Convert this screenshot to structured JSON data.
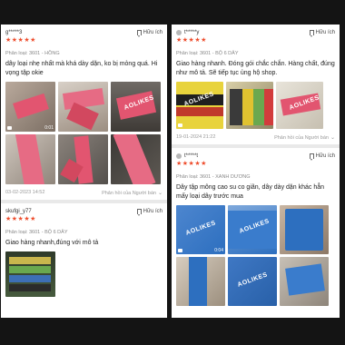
{
  "colors": {
    "star": "#ee4d2d",
    "pink_band": "#e25570",
    "blue_band": "#2d6fbf"
  },
  "save_label": "Hữu ích",
  "reply_label": "Phản hồi của Người bán",
  "left": {
    "reviews": [
      {
        "user": "g*****3",
        "stars": "★★★★★",
        "variant": "Phân loại: 3601 - HỒNG",
        "text": "dây loại nhẹ nhất mà khá dày  dặn, ko bị mỏng quá. Hi vọng tập okie",
        "video_duration": "0:01",
        "date": "03-02-2023 14:52"
      },
      {
        "user": "skufgi_y77",
        "stars": "★★★★★",
        "variant": "Phân loại: 3601 - BỘ 6 DÂY",
        "text": "Giao hàng nhanh,đúng với mô tả"
      }
    ]
  },
  "right": {
    "reviews": [
      {
        "user": "t*****y",
        "stars": "★★★★★",
        "variant": "Phân loại: 3601 - BỘ 6 DÂY",
        "text": "Giao hàng nhanh. Đóng gói chắc chắn. Hàng chất, đúng như mô tả. Sẽ tiếp tục ủng hộ shop.",
        "date": "19-01-2024 21:22"
      },
      {
        "user": "t*****t",
        "stars": "★★★★★",
        "variant": "Phân loại: 3601 - XANH DƯƠNG",
        "text": "Dây tập mông cao su co giãn, dây dày dặn khác hẳn mấy loại dây trước mua",
        "video_duration": "0:04"
      }
    ]
  },
  "brand_text": "AOLIKES"
}
